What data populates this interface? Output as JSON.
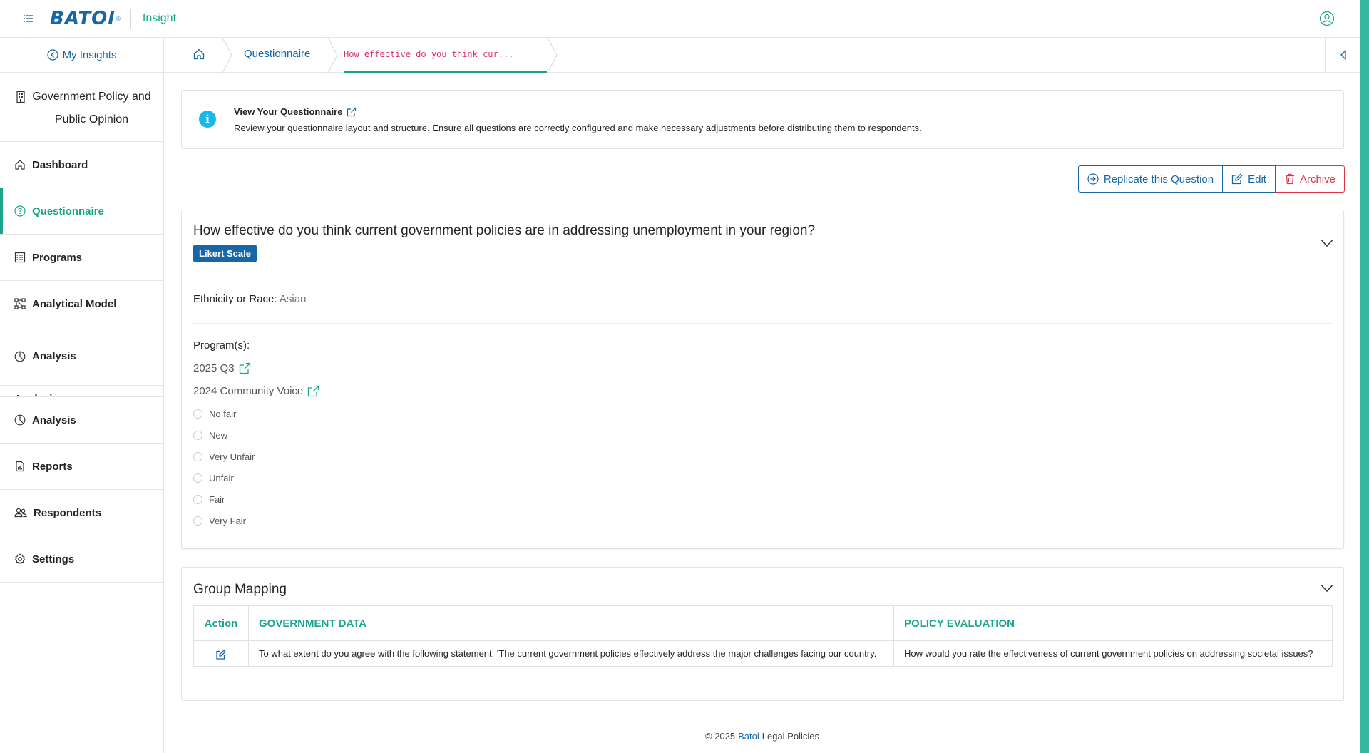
{
  "header": {
    "logo_text": "BATOI",
    "logo_reg": "®",
    "app_name": "Insight"
  },
  "sidebar": {
    "my_insights": "My Insights",
    "project_title": "Government Policy and Public Opinion",
    "items": [
      {
        "label": "Dashboard",
        "icon": "home-icon"
      },
      {
        "label": "Questionnaire",
        "icon": "question-circle-icon",
        "active": true
      },
      {
        "label": "Programs",
        "icon": "list-icon"
      },
      {
        "label": "Analytical Model",
        "icon": "model-icon"
      },
      {
        "label": "Analysis",
        "icon": "pie-chart-icon"
      },
      {
        "label": "Analysis",
        "icon": "pie-chart-icon"
      },
      {
        "label": "Reports",
        "icon": "report-icon"
      },
      {
        "label": "Respondents",
        "icon": "users-icon"
      },
      {
        "label": "Settings",
        "icon": "gear-icon"
      }
    ]
  },
  "breadcrumb": {
    "section": "Questionnaire",
    "current": "How effective do you think cur..."
  },
  "info": {
    "title": "View Your Questionnaire",
    "description": "Review your questionnaire layout and structure. Ensure all questions are correctly configured and make necessary adjustments before distributing them to respondents."
  },
  "actions": {
    "replicate": "Replicate this Question",
    "edit": "Edit",
    "archive": "Archive"
  },
  "question": {
    "title": "How effective do you think current government policies are in addressing unemployment in your region?",
    "type_badge": "Likert Scale",
    "ethnicity_label": "Ethnicity or Race:",
    "ethnicity_value": "Asian",
    "programs_label": "Program(s):",
    "programs": [
      "2025 Q3",
      "2024 Community Voice"
    ],
    "options": [
      "No fair",
      "New",
      "Very Unfair",
      "Unfair",
      "Fair",
      "Very Fair"
    ]
  },
  "group_mapping": {
    "title": "Group Mapping",
    "columns": [
      "Action",
      "GOVERNMENT DATA",
      "POLICY EVALUATION"
    ],
    "rows": [
      {
        "government_data": "To what extent do you agree with the following statement: 'The current government policies effectively address the major challenges facing our country.",
        "policy_evaluation": "How would you rate the effectiveness of current government policies on addressing societal issues?"
      }
    ]
  },
  "footer": {
    "copyright": "© 2025",
    "brand": "Batoi",
    "suffix": "Legal Policies"
  },
  "colors": {
    "primary": "#1666a8",
    "accent": "#1aa58b",
    "danger": "#dc3545",
    "info": "#17b9e8"
  }
}
